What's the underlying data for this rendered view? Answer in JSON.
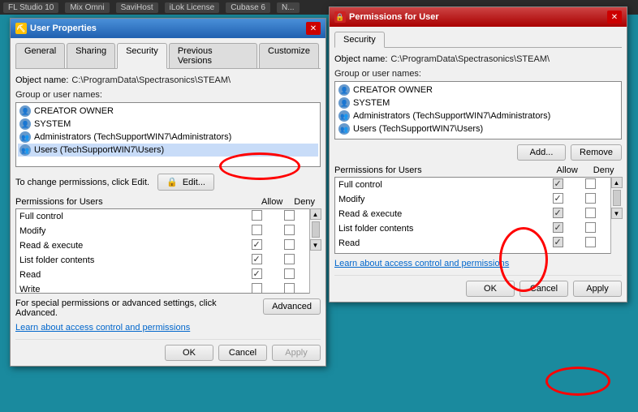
{
  "taskbar": {
    "items": [
      "FL Studio 10",
      "Mix Omni",
      "SaviHost",
      "iLok License",
      "Cubase 6",
      "N..."
    ]
  },
  "dialog1": {
    "title": "User Properties",
    "tabs": [
      "General",
      "Sharing",
      "Security",
      "Previous Versions",
      "Customize"
    ],
    "active_tab": "Security",
    "object_name_label": "Object name:",
    "object_name_value": "C:\\ProgramData\\Spectrasonics\\STEAM\\",
    "group_label": "Group or user names:",
    "users": [
      "CREATOR OWNER",
      "SYSTEM",
      "Administrators (TechSupportWIN7\\Administrators)",
      "Users (TechSupportWIN7\\Users)"
    ],
    "edit_hint": "To change permissions, click Edit.",
    "edit_btn": "Edit...",
    "perms_header": "Permissions for Users",
    "allow_label": "Allow",
    "deny_label": "Deny",
    "permissions": [
      {
        "name": "Full control",
        "allow": false,
        "deny": false
      },
      {
        "name": "Modify",
        "allow": false,
        "deny": false
      },
      {
        "name": "Read & execute",
        "allow": true,
        "deny": false
      },
      {
        "name": "List folder contents",
        "allow": true,
        "deny": false
      },
      {
        "name": "Read",
        "allow": true,
        "deny": false
      },
      {
        "name": "Write",
        "allow": false,
        "deny": false
      }
    ],
    "special_text": "For special permissions or advanced settings, click Advanced.",
    "advanced_btn": "Advanced",
    "link_text": "Learn about access control and permissions",
    "ok_btn": "OK",
    "cancel_btn": "Cancel",
    "apply_btn": "Apply"
  },
  "dialog2": {
    "title": "Permissions for User",
    "tab": "Security",
    "object_name_label": "Object name:",
    "object_name_value": "C:\\ProgramData\\Spectrasonics\\STEAM\\",
    "group_label": "Group or user names:",
    "users": [
      "CREATOR OWNER",
      "SYSTEM",
      "Administrators (TechSupportWIN7\\Administrators)",
      "Users (TechSupportWIN7\\Users)"
    ],
    "add_btn": "Add...",
    "remove_btn": "Remove",
    "perms_header": "Permissions for Users",
    "allow_label": "Allow",
    "deny_label": "Deny",
    "permissions": [
      {
        "name": "Full control",
        "allow_checked": true,
        "deny_checked": false
      },
      {
        "name": "Modify",
        "allow_checked": true,
        "deny_checked": false
      },
      {
        "name": "Read & execute",
        "allow_checked": true,
        "deny_checked": false
      },
      {
        "name": "List folder contents",
        "allow_checked": true,
        "deny_checked": false
      },
      {
        "name": "Read",
        "allow_checked": true,
        "deny_checked": false
      }
    ],
    "link_text": "Learn about access control and permissions",
    "ok_btn": "OK",
    "cancel_btn": "Cancel",
    "apply_btn": "Apply"
  }
}
